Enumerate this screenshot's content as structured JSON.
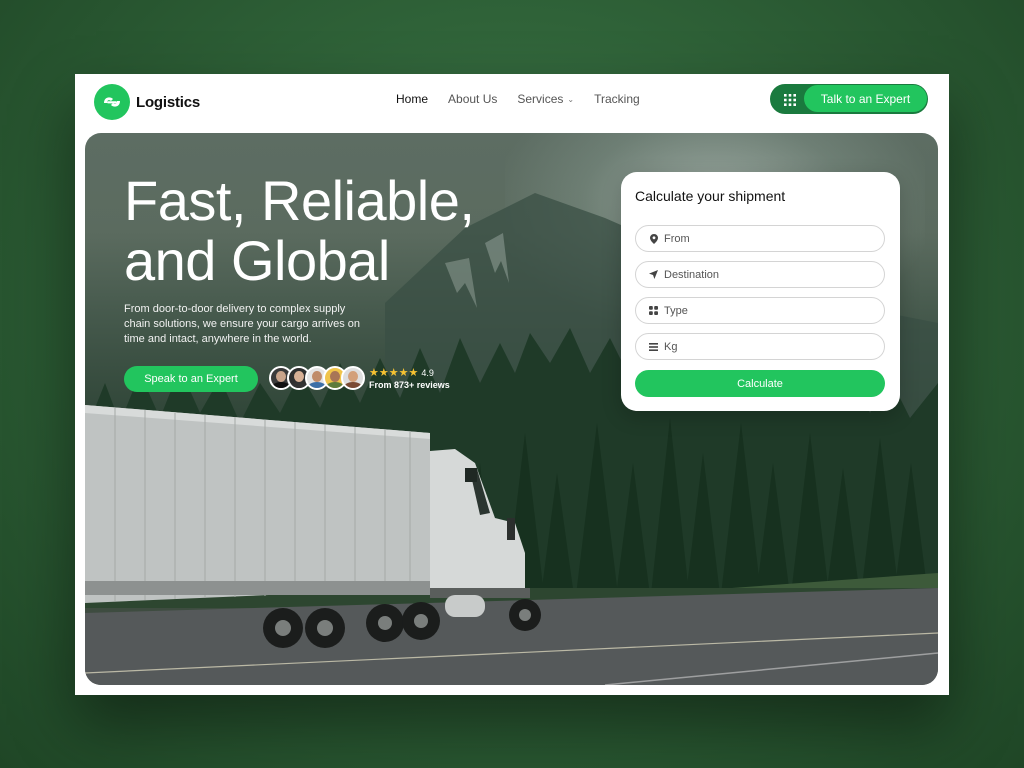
{
  "brand": {
    "name": "Logistics",
    "accent": "#22c55e",
    "accent_dark": "#1a7a3e"
  },
  "nav": {
    "items": [
      {
        "label": "Home",
        "active": true
      },
      {
        "label": "About Us"
      },
      {
        "label": "Services",
        "has_dropdown": true
      },
      {
        "label": "Tracking"
      }
    ],
    "cta_label": "Talk to an Expert",
    "cta_icon": "grid-icon"
  },
  "hero": {
    "title_line1": "Fast, Reliable,",
    "title_line2": "and Global",
    "subtitle": "From door-to-door delivery to complex supply chain solutions, we ensure your cargo arrives on time and intact, anywhere in the world.",
    "cta_label": "Speak to an Expert",
    "rating": {
      "stars": 5,
      "score": "4.9",
      "reviews": "From 873+ reviews"
    }
  },
  "calculator": {
    "title": "Calculate your shipment",
    "fields": [
      {
        "placeholder": "From",
        "icon": "location-pin-icon"
      },
      {
        "placeholder": "Destination",
        "icon": "navigation-arrow-icon"
      },
      {
        "placeholder": "Type",
        "icon": "grid-icon"
      },
      {
        "placeholder": "Kg",
        "icon": "weight-icon"
      }
    ],
    "submit_label": "Calculate"
  }
}
